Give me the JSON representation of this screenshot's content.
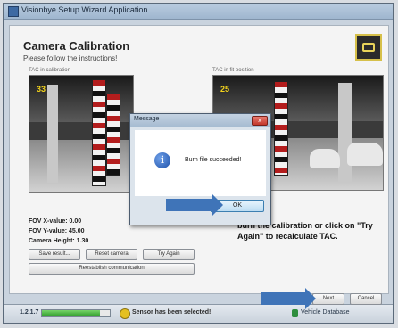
{
  "window": {
    "title": "Visionbye Setup Wizard Application"
  },
  "page": {
    "title": "Camera Calibration",
    "subtitle": "Please follow the instructions!"
  },
  "panels": {
    "left_label": "TAC in calibration",
    "right_label": "TAC in fit position",
    "left_number": "33",
    "right_number": "25"
  },
  "readouts": {
    "fov_x": "FOV X-value: 0.00",
    "fov_y": "FOV Y-value: 45.00",
    "camera_height": "Camera Height: 1.30"
  },
  "buttons": {
    "save": "Save result...",
    "reset_camera": "Reset camera",
    "try_again": "Try Again",
    "reestablish": "Reestablish communication",
    "next": "Next",
    "cancel": "Cancel"
  },
  "instruction": "burn the calibration or click on \"Try Again\" to recalculate TAC.",
  "dialog": {
    "title": "Message",
    "message": "Burn file succeeded!",
    "ok": "OK",
    "close": "x"
  },
  "statusbar": {
    "version": "1.2.1.7",
    "progress": 0.85,
    "status": "Sensor has been selected!",
    "database": "Vehicle Database"
  },
  "colors": {
    "accent_arrow": "#3f74b8",
    "progress": "#2f9b2a",
    "warning": "#e4c020"
  }
}
